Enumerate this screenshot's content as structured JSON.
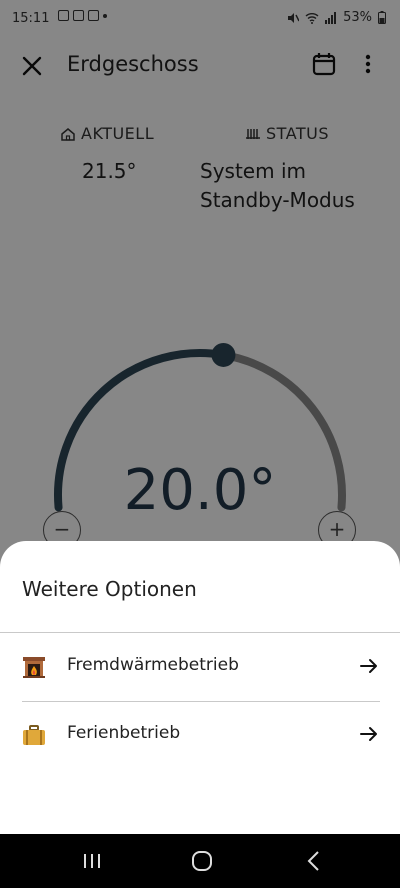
{
  "status_bar": {
    "time": "15:11",
    "battery": "53%"
  },
  "app_bar": {
    "title": "Erdgeschoss",
    "icons": [
      "close-icon",
      "calendar-icon",
      "more-vert-icon"
    ]
  },
  "info": {
    "current_label": "AKTUELL",
    "current_value": "21.5°",
    "status_label": "STATUS",
    "status_value_line1": "System im",
    "status_value_line2": "Standby-Modus"
  },
  "thermostat": {
    "setpoint": "20.0°",
    "minus": "−",
    "plus": "+",
    "dial_fraction": 0.55,
    "colors": {
      "active": "#2f4756",
      "inactive": "#8a8a8a"
    }
  },
  "sheet": {
    "title": "Weitere Optionen",
    "options": [
      {
        "label": "Fremdwärmebetrieb",
        "icon": "fireplace-icon"
      },
      {
        "label": "Ferienbetrieb",
        "icon": "suitcase-icon"
      }
    ]
  }
}
